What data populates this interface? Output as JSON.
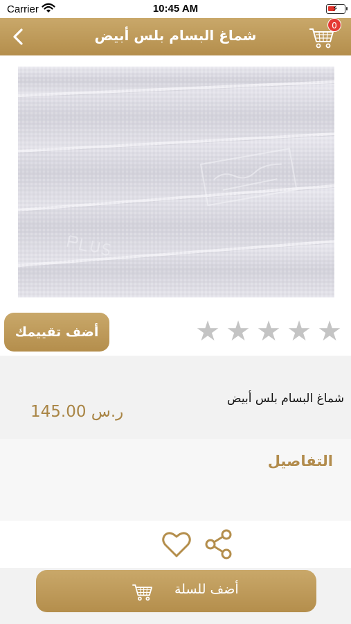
{
  "status_bar": {
    "carrier": "Carrier",
    "time": "10:45 AM"
  },
  "nav": {
    "title": "شماغ البسام بلس أبيض",
    "cart_badge": "0"
  },
  "product": {
    "name": "شماغ البسام بلس أبيض",
    "price_amount": "145.00",
    "price_currency": "ر.س",
    "rating": 0,
    "rating_max": 5
  },
  "rating": {
    "button_label": "أضف تقييمك",
    "stars": [
      "★",
      "★",
      "★",
      "★",
      "★"
    ]
  },
  "details": {
    "title": "التفاصيل"
  },
  "cart_button": {
    "label": "أضف للسلة"
  },
  "colors": {
    "accent": "#b48e4c",
    "price": "#a98545",
    "badge": "#e53935",
    "star_empty": "#c4c4c4"
  },
  "icons": {
    "back": "chevron-left-icon",
    "cart": "shopping-cart-icon",
    "heart": "heart-icon",
    "share": "share-icon",
    "wifi": "wifi-icon",
    "battery": "battery-icon"
  }
}
